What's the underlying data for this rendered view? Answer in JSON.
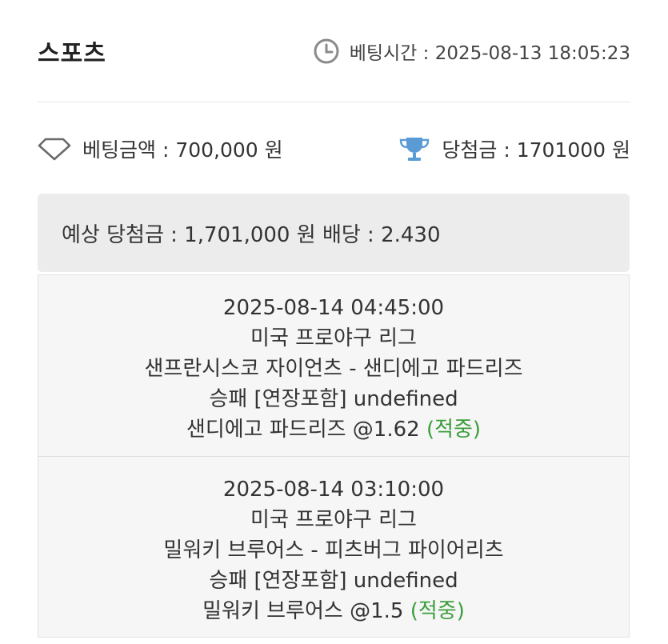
{
  "header": {
    "title": "스포츠",
    "bet_time_label": "베팅시간 : 2025-08-13 18:05:23"
  },
  "summary": {
    "bet_amount_label": "베팅금액 : 700,000 원",
    "win_amount_label": "당첨금 : 1701000 원"
  },
  "expected": {
    "label": "예상 당첨금 : 1,701,000 원",
    "odds_label": "배당 : 2.430"
  },
  "bets": [
    {
      "datetime": "2025-08-14 04:45:00",
      "league": "미국 프로야구 리그",
      "match": "샌프란시스코 자이언츠 - 샌디에고 파드리즈",
      "market": "승패 [연장포함] undefined",
      "pick": "샌디에고 파드리즈 @1.62",
      "result": "(적중)"
    },
    {
      "datetime": "2025-08-14 03:10:00",
      "league": "미국 프로야구 리그",
      "match": "밀워키 브루어스 - 피츠버그 파이어리츠",
      "market": "승패 [연장포함] undefined",
      "pick": "밀워키 브루어스 @1.5",
      "result": "(적중)"
    }
  ],
  "icons": {
    "clock": "clock-icon",
    "diamond": "diamond-icon",
    "trophy": "trophy-icon"
  },
  "colors": {
    "result_green": "#3b9e3b",
    "trophy_blue": "#5a9bd5",
    "panel_gray": "#ececec"
  }
}
